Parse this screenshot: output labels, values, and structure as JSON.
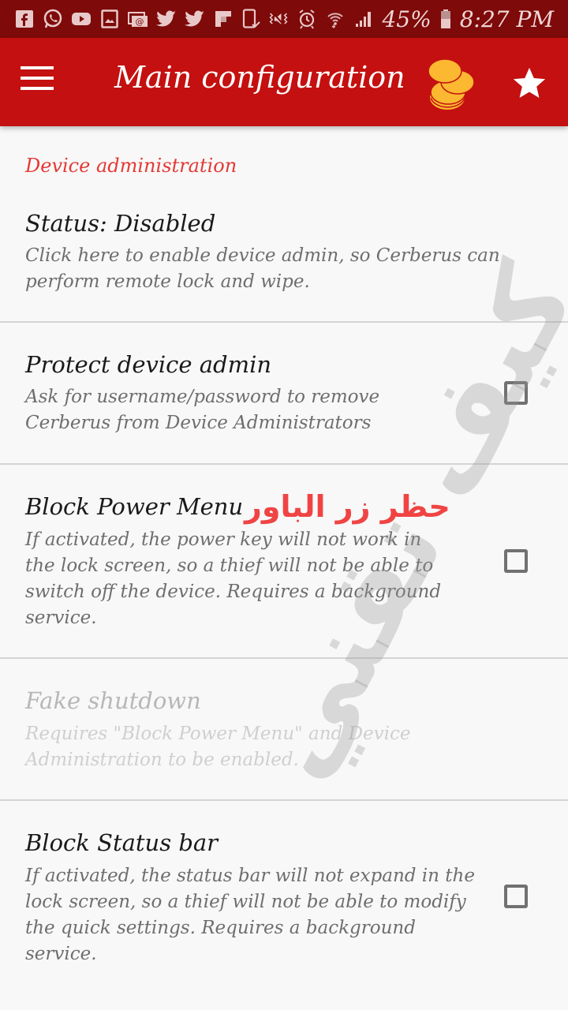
{
  "status_bar": {
    "notification_icons": [
      "facebook-icon",
      "whatsapp-icon",
      "youtube-icon",
      "gallery-icon",
      "email-icon",
      "twitter-icon",
      "twitter-icon",
      "flipboard-icon",
      "phone-check-icon"
    ],
    "system_icons": [
      "vibrate-mute-icon",
      "alarm-icon",
      "wifi-icon",
      "signal-icon"
    ],
    "battery": "45%",
    "time": "8:27 PM"
  },
  "app_bar": {
    "title": "Main configuration",
    "menu_icon": "hamburger-menu-icon",
    "coins_icon": "coins-icon",
    "star_icon": "star-icon"
  },
  "colors": {
    "status_bar": "#7e0a0a",
    "app_bar": "#c41010",
    "section_header": "#e53935",
    "coins": "#fbb830",
    "annotation": "#f04444"
  },
  "section": {
    "header": "Device administration"
  },
  "preferences": [
    {
      "title": "Status: Disabled",
      "summary": "Click here to enable device admin, so Cerberus can perform remote lock and wipe.",
      "has_checkbox": false,
      "enabled": true
    },
    {
      "title": "Protect device admin",
      "summary": "Ask for username/password to remove Cerberus from Device Administrators",
      "has_checkbox": true,
      "checked": false,
      "enabled": true
    },
    {
      "title": "Block Power Menu",
      "summary": "If activated, the power key will not work in the lock screen, so a thief will not be able to switch off the device. Requires a background service.",
      "has_checkbox": true,
      "checked": false,
      "enabled": true
    },
    {
      "title": "Fake shutdown",
      "summary": "Requires \"Block Power Menu\" and Device Administration to be enabled.",
      "has_checkbox": false,
      "enabled": false
    },
    {
      "title": "Block Status bar",
      "summary": "If activated, the status bar will not expand in the lock screen, so a thief will not be able to modify the quick settings. Requires a background service.",
      "has_checkbox": true,
      "checked": false,
      "enabled": true
    }
  ],
  "overlay": {
    "annotation_text": "حظر زر الباور",
    "watermark_text": "كيف تقني"
  }
}
